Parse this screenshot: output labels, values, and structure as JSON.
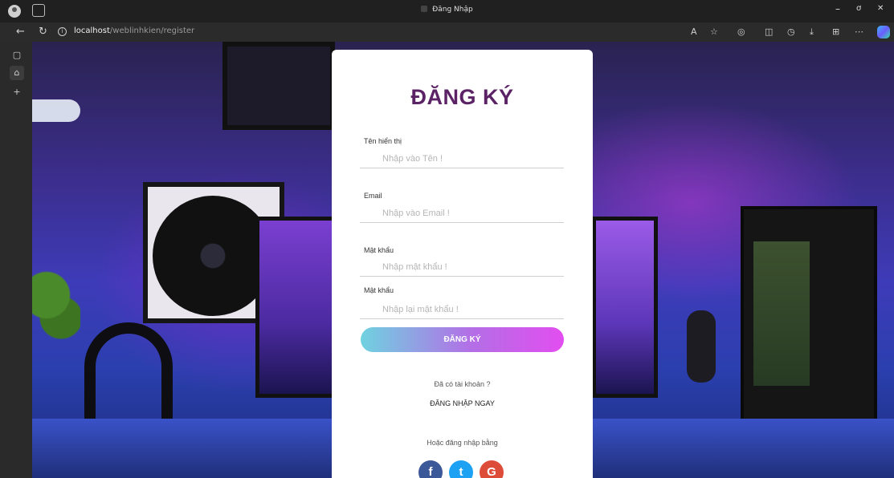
{
  "browser": {
    "window_title": "Đăng Nhập",
    "url_host": "localhost",
    "url_path": "/weblinhkien/register",
    "controls": {
      "minimize": "–",
      "restore": "ơ",
      "close": "✕"
    }
  },
  "form": {
    "title": "ĐĂNG KÝ",
    "fields": [
      {
        "label": "Tên hiển thị",
        "placeholder": "Nhập vào Tên !"
      },
      {
        "label": "Email",
        "placeholder": "Nhập vào Email !"
      },
      {
        "label": "Mật khẩu",
        "placeholder": "Nhập mật khẩu !"
      },
      {
        "label": "Mật khẩu",
        "placeholder": "Nhập lại mật khẩu !"
      }
    ],
    "submit_label": "ĐĂNG KÝ",
    "have_account_text": "Đã có tài khoản ?",
    "login_now_label": "ĐĂNG NHẬP NGAY",
    "or_login_with": "Hoặc đăng nhập bằng",
    "social": [
      {
        "name": "facebook",
        "glyph": "f",
        "color": "#3b5998"
      },
      {
        "name": "twitter",
        "glyph": "t",
        "color": "#1da1f2"
      },
      {
        "name": "google",
        "glyph": "G",
        "color": "#dd4b39"
      }
    ],
    "colors": {
      "title": "#5b2366",
      "button_start": "#6fd2e0",
      "button_end": "#e24ef0"
    }
  }
}
